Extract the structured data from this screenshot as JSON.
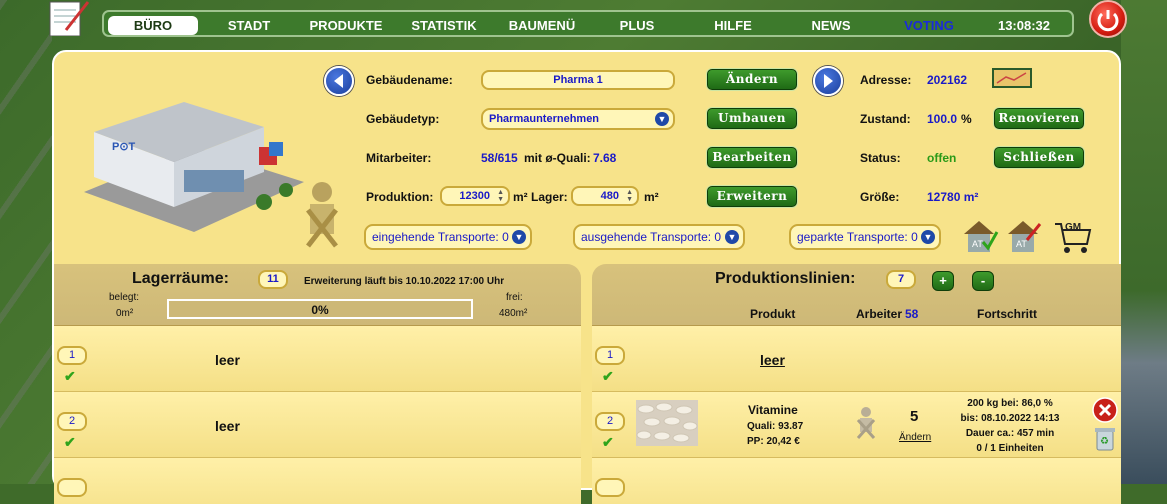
{
  "nav": {
    "items": [
      "BÜRO",
      "STADT",
      "PRODUKTE",
      "STATISTIK",
      "BAUMENÜ",
      "PLUS",
      "HILFE",
      "NEWS",
      "VOTING"
    ],
    "time": "13:08:32"
  },
  "building": {
    "name_label": "Gebäudename:",
    "name": "Pharma 1",
    "change_btn": "Ändern",
    "type_label": "Gebäudetyp:",
    "type": "Pharmaunternehmen",
    "rebuild_btn": "Umbauen",
    "staff_label": "Mitarbeiter:",
    "staff": "58/615",
    "quali_text": "mit ø-Quali:",
    "quali": "7.68",
    "edit_btn": "Bearbeiten",
    "production_label": "Produktion:",
    "production": "12300",
    "production_unit": "m²",
    "storage_label": "Lager:",
    "storage": "480",
    "storage_unit": "m²",
    "expand_btn": "Erweitern",
    "address_label": "Adresse:",
    "address": "202162",
    "condition_label": "Zustand:",
    "condition": "100.0",
    "condition_unit": "%",
    "renovate_btn": "Renovieren",
    "status_label": "Status:",
    "status": "offen",
    "close_btn": "Schließen",
    "size_label": "Größe:",
    "size": "12780 m²",
    "transport_in": "eingehende Transporte: 0",
    "transport_out": "ausgehende Transporte: 0",
    "transport_parked": "geparkte Transporte: 0"
  },
  "storage": {
    "title": "Lagerräume:",
    "count": "11",
    "expansion": "Erweiterung läuft bis 10.10.2022 17:00 Uhr",
    "used_label": "belegt:",
    "used": "0m²",
    "free_label": "frei:",
    "free": "480m²",
    "progress_text": "0%",
    "progress": 0,
    "rows": [
      {
        "num": "1",
        "text": "leer"
      },
      {
        "num": "2",
        "text": "leer"
      }
    ]
  },
  "production": {
    "title": "Produktionslinien:",
    "count": "7",
    "add": "+",
    "remove": "-",
    "col_product": "Produkt",
    "col_workers": "Arbeiter",
    "workers_total": "58",
    "col_progress": "Fortschritt",
    "rows": [
      {
        "num": "1",
        "text": "leer"
      },
      {
        "num": "2",
        "product": "Vitamine",
        "quali": "Quali: 93.87",
        "pp": "PP: 20,42 €",
        "workers": "5",
        "change": "Ändern",
        "p1": "200 kg bei: 86,0 %",
        "p2": "bis: 08.10.2022 14:13",
        "p3": "Dauer ca.: 457 min",
        "p4": "0 / 1 Einheiten"
      }
    ]
  }
}
